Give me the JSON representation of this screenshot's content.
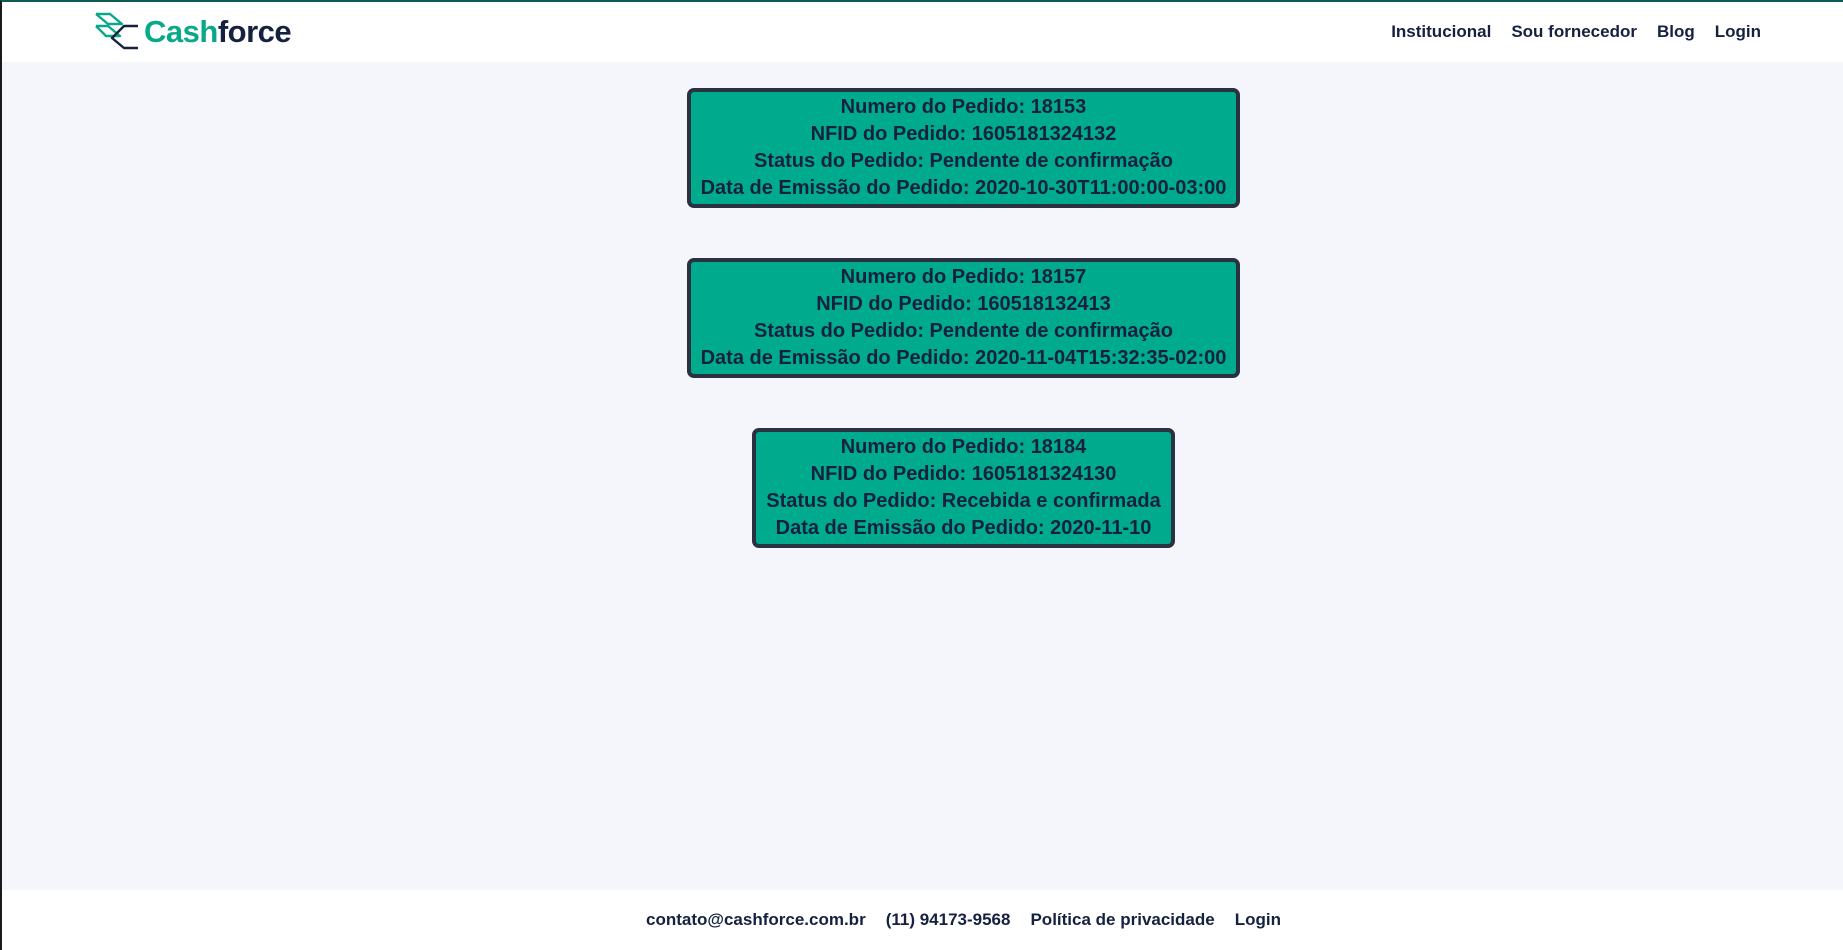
{
  "header": {
    "logo": {
      "icon": "cashforce-chevron-logo-icon",
      "text_cash": "Cash",
      "text_force": "force"
    },
    "nav": [
      {
        "label": "Institucional"
      },
      {
        "label": "Sou fornecedor"
      },
      {
        "label": "Blog"
      },
      {
        "label": "Login"
      }
    ]
  },
  "orders": [
    {
      "number_line": "Numero do Pedido: 18153",
      "nfid_line": "NFID do Pedido: 1605181324132",
      "status_line": "Status do Pedido: Pendente de confirmação",
      "date_line": "Data de Emissão do Pedido: 2020-10-30T11:00:00-03:00"
    },
    {
      "number_line": "Numero do Pedido: 18157",
      "nfid_line": "NFID do Pedido: 160518132413",
      "status_line": "Status do Pedido: Pendente de confirmação",
      "date_line": "Data de Emissão do Pedido: 2020-11-04T15:32:35-02:00"
    },
    {
      "number_line": "Numero do Pedido: 18184",
      "nfid_line": "NFID do Pedido: 1605181324130",
      "status_line": "Status do Pedido: Recebida e confirmada",
      "date_line": "Data de Emissão do Pedido: 2020-11-10"
    }
  ],
  "footer": {
    "email": "contato@cashforce.com.br",
    "phone": "(11) 94173-9568",
    "privacy": "Política de privacidade",
    "login": "Login"
  },
  "colors": {
    "brand_green": "#00ab8d",
    "brand_navy": "#15213f",
    "card_border": "#2a3141",
    "page_bg": "#f4f6fb"
  }
}
